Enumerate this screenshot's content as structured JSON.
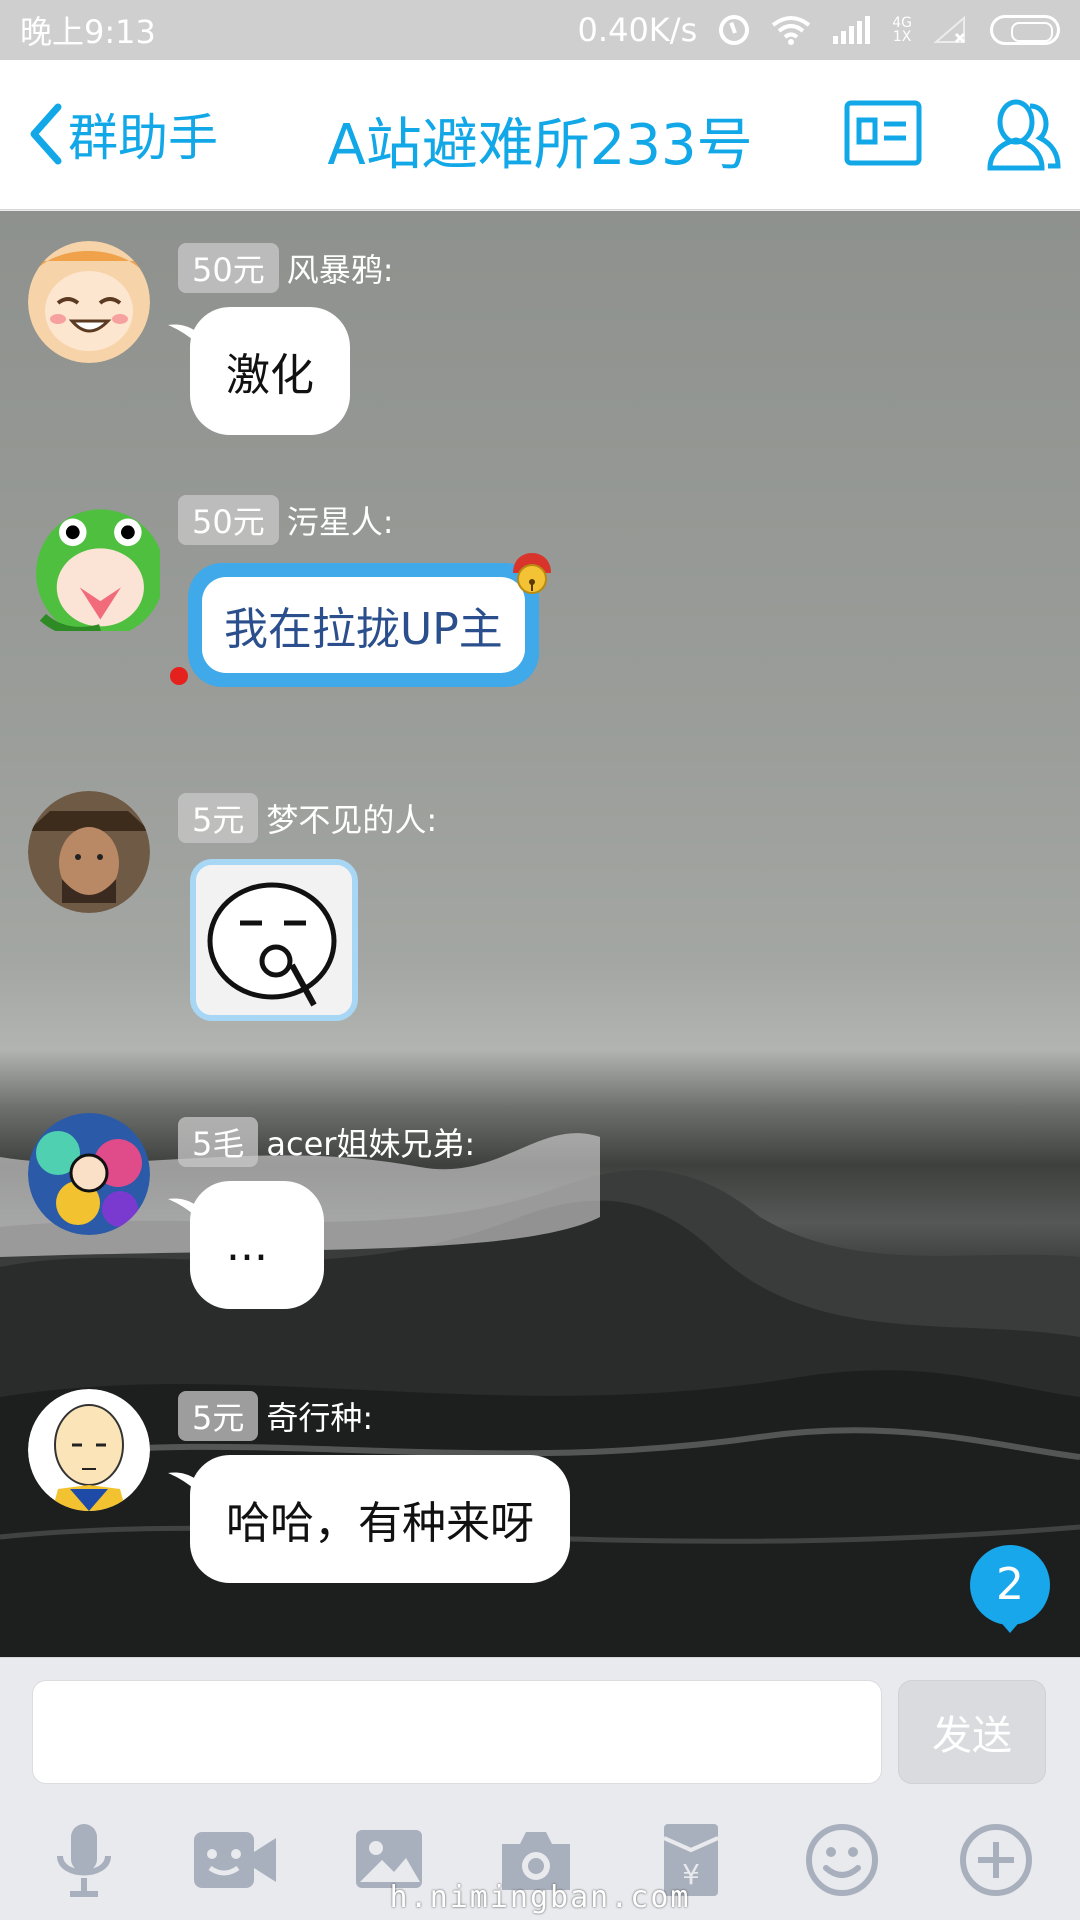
{
  "status_bar": {
    "time": "晚上9:13",
    "speed": "0.40K/s",
    "net_type_top": "4G",
    "net_type_bottom": "1X"
  },
  "header": {
    "back_label": "群助手",
    "title": "A站避难所233号",
    "icons": [
      "card-icon",
      "group-members-icon"
    ]
  },
  "messages": [
    {
      "badge": "50元",
      "sender": "风暴鸦:",
      "text": "激化",
      "type": "text"
    },
    {
      "badge": "50元",
      "sender": "污星人:",
      "text": "我在拉拢UP主",
      "type": "special"
    },
    {
      "badge": "5元",
      "sender": "梦不见的人:",
      "text": "",
      "type": "sticker"
    },
    {
      "badge": "5毛",
      "sender": "acer姐妹兄弟:",
      "text": "...",
      "type": "text"
    },
    {
      "badge": "5元",
      "sender": "奇行种:",
      "text": "哈哈，有种来呀",
      "type": "text"
    }
  ],
  "unread_count": "2",
  "input": {
    "value": "",
    "send_label": "发送"
  },
  "toolbar": {
    "icons": [
      "microphone-icon",
      "video-chat-icon",
      "image-icon",
      "camera-icon",
      "red-packet-icon",
      "emoji-icon",
      "plus-icon"
    ]
  },
  "watermark": "h.nimingban.com",
  "colors": {
    "accent": "#12a8e8",
    "special_bubble": "#3fa9ea",
    "special_text": "#2b4f8c",
    "unread_badge": "#18a7ea"
  }
}
